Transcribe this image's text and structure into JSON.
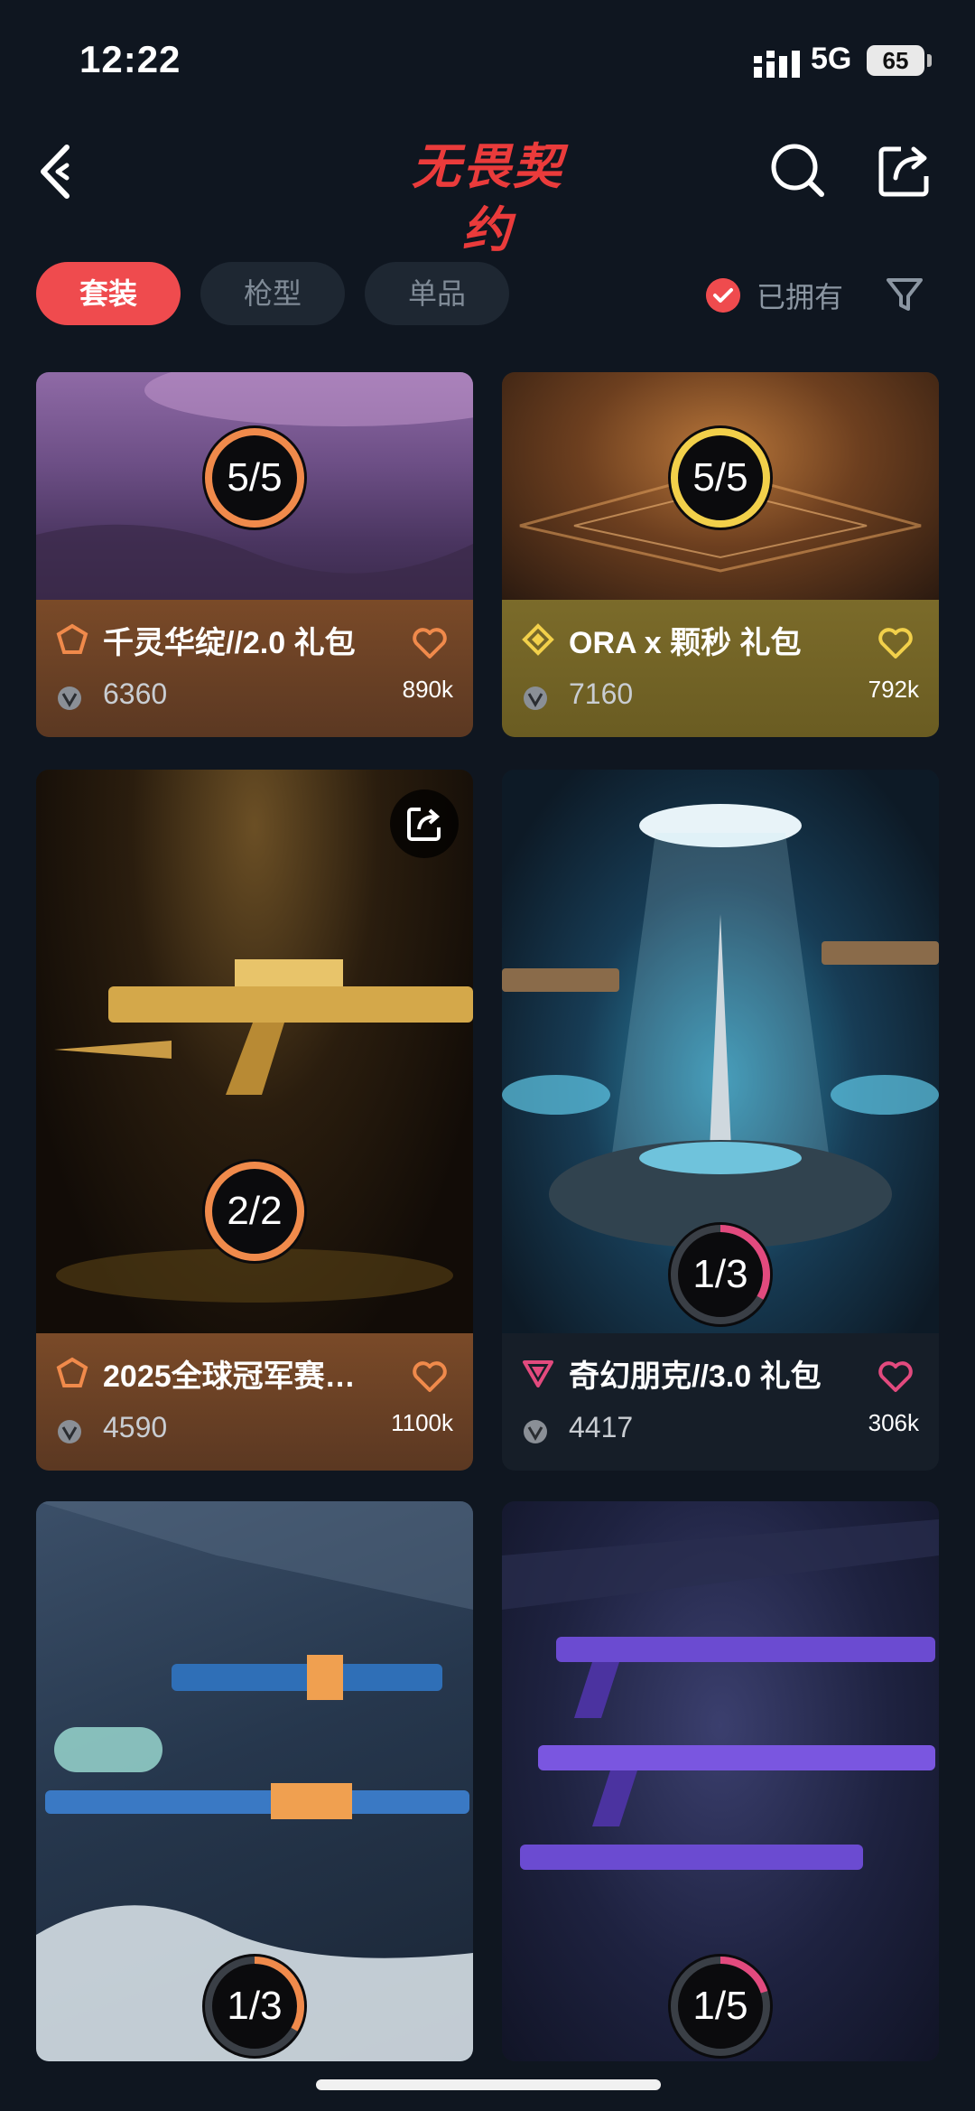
{
  "status_bar": {
    "time": "12:22",
    "network": "5G",
    "battery": "65"
  },
  "header": {
    "logo_text": "无畏契约"
  },
  "filters": {
    "tabs": [
      {
        "label": "套装",
        "active": true
      },
      {
        "label": "枪型",
        "active": false
      },
      {
        "label": "单品",
        "active": false
      }
    ],
    "owned_label": "已拥有"
  },
  "cards": [
    {
      "title": "千灵华绽//2.0 礼包",
      "price": "6360",
      "likes": "890k",
      "progress": "5/5",
      "tier": "orange"
    },
    {
      "title": "ORA x 颗秒 礼包",
      "price": "7160",
      "likes": "792k",
      "progress": "5/5",
      "tier": "gold"
    },
    {
      "title": "2025全球冠军赛…",
      "price": "4590",
      "likes": "1100k",
      "progress": "2/2",
      "tier": "orange"
    },
    {
      "title": "奇幻朋克//3.0 礼包",
      "price": "4417",
      "likes": "306k",
      "progress": "1/3",
      "tier": "pink"
    },
    {
      "progress": "1/3",
      "tier": "orange"
    },
    {
      "progress": "1/5",
      "tier": "pink"
    }
  ],
  "colors": {
    "accent": "#ef4b4e",
    "orange_tier": "#f08a4b",
    "gold_tier": "#f2d04a",
    "pink_tier": "#e24a7e"
  }
}
